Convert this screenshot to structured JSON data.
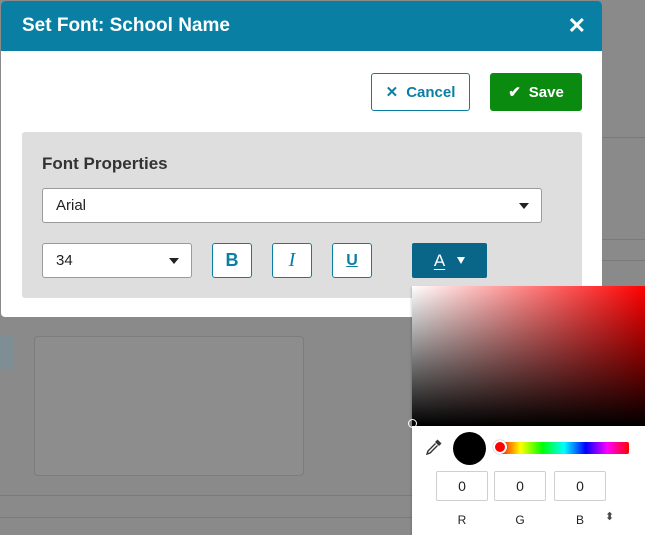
{
  "dialog": {
    "title": "Set Font: School Name",
    "close_glyph": "✕",
    "cancel_label": "Cancel",
    "cancel_icon": "✕",
    "save_label": "Save",
    "save_icon": "✔"
  },
  "font_properties": {
    "heading": "Font Properties",
    "font_family": "Arial",
    "font_size": "34",
    "bold_glyph": "B",
    "italic_glyph": "I",
    "underline_glyph": "U",
    "color_glyph": "A"
  },
  "color_picker": {
    "r": "0",
    "g": "0",
    "b": "0",
    "r_label": "R",
    "g_label": "G",
    "b_label": "B",
    "mode_toggle_glyph": "⬍",
    "current_color": "#000000",
    "hue_color": "#ff0000"
  },
  "colors": {
    "header": "#0a7fa4",
    "save": "#0b8a10",
    "color_button": "#0a6688"
  }
}
